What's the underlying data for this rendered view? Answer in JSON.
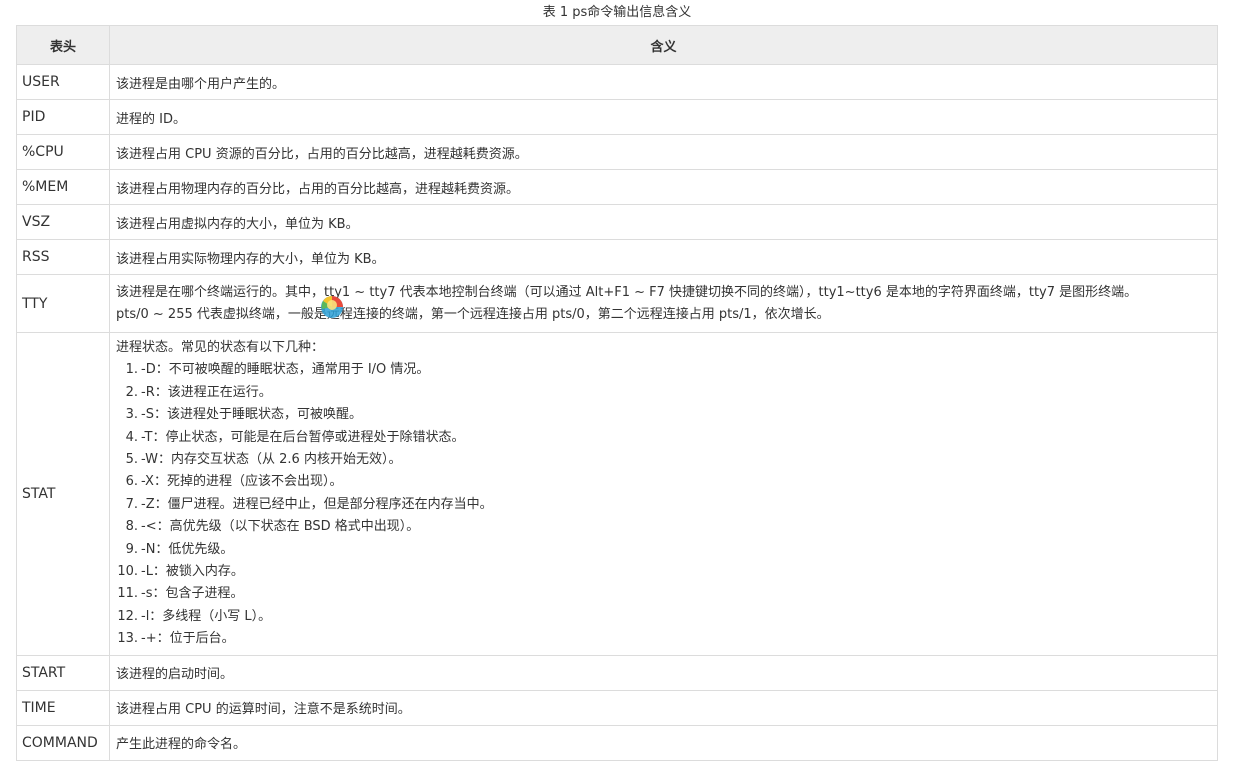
{
  "caption": "表 1 ps命令输出信息含义",
  "headers": {
    "col1": "表头",
    "col2": "含义"
  },
  "rows": [
    {
      "key": "USER",
      "value": "该进程是由哪个用户产生的。"
    },
    {
      "key": "PID",
      "value": "进程的 ID。"
    },
    {
      "key": "%CPU",
      "value": "该进程占用 CPU 资源的百分比，占用的百分比越高，进程越耗费资源。"
    },
    {
      "key": "%MEM",
      "value": "该进程占用物理内存的百分比，占用的百分比越高，进程越耗费资源。"
    },
    {
      "key": "VSZ",
      "value": "该进程占用虚拟内存的大小，单位为 KB。"
    },
    {
      "key": "RSS",
      "value": "该进程占用实际物理内存的大小，单位为 KB。"
    },
    {
      "key": "TTY",
      "line1": "该进程是在哪个终端运行的。其中，tty1 ~ tty7 代表本地控制台终端（可以通过 Alt+F1 ~ F7 快捷键切换不同的终端），tty1~tty6 是本地的字符界面终端，tty7 是图形终端。",
      "line2": "pts/0 ~ 255 代表虚拟终端，一般是远程连接的终端，第一个远程连接占用 pts/0，第二个远程连接占用 pts/1，依次增长。"
    },
    {
      "key": "STAT",
      "intro": "进程状态。常见的状态有以下几种：",
      "items": [
        {
          "num": "1.",
          "text": "-D：不可被唤醒的睡眠状态，通常用于 I/O 情况。"
        },
        {
          "num": "2.",
          "text": "-R：该进程正在运行。"
        },
        {
          "num": "3.",
          "text": "-S：该进程处于睡眠状态，可被唤醒。"
        },
        {
          "num": "4.",
          "text": "-T：停止状态，可能是在后台暂停或进程处于除错状态。"
        },
        {
          "num": "5.",
          "text": "-W：内存交互状态（从 2.6 内核开始无效）。"
        },
        {
          "num": "6.",
          "text": "-X：死掉的进程（应该不会出现）。"
        },
        {
          "num": "7.",
          "text": "-Z：僵尸进程。进程已经中止，但是部分程序还在内存当中。"
        },
        {
          "num": "8.",
          "text": "-<：高优先级（以下状态在 BSD 格式中出现）。"
        },
        {
          "num": "9.",
          "text": "-N：低优先级。"
        },
        {
          "num": "10.",
          "text": "-L：被锁入内存。"
        },
        {
          "num": "11.",
          "text": "-s：包含子进程。"
        },
        {
          "num": "12.",
          "text": "-l：多线程（小写 L）。"
        },
        {
          "num": "13.",
          "text": "-+：位于后台。"
        }
      ]
    },
    {
      "key": "START",
      "value": "该进程的启动时间。"
    },
    {
      "key": "TIME",
      "value": "该进程占用 CPU 的运算时间，注意不是系统时间。"
    },
    {
      "key": "COMMAND",
      "value": "产生此进程的命令名。"
    }
  ],
  "colors": {
    "header_bg": "#eeeeee",
    "border": "#dcdcdc",
    "text": "#333333"
  },
  "cursor_icon": "loading-cursor-icon"
}
